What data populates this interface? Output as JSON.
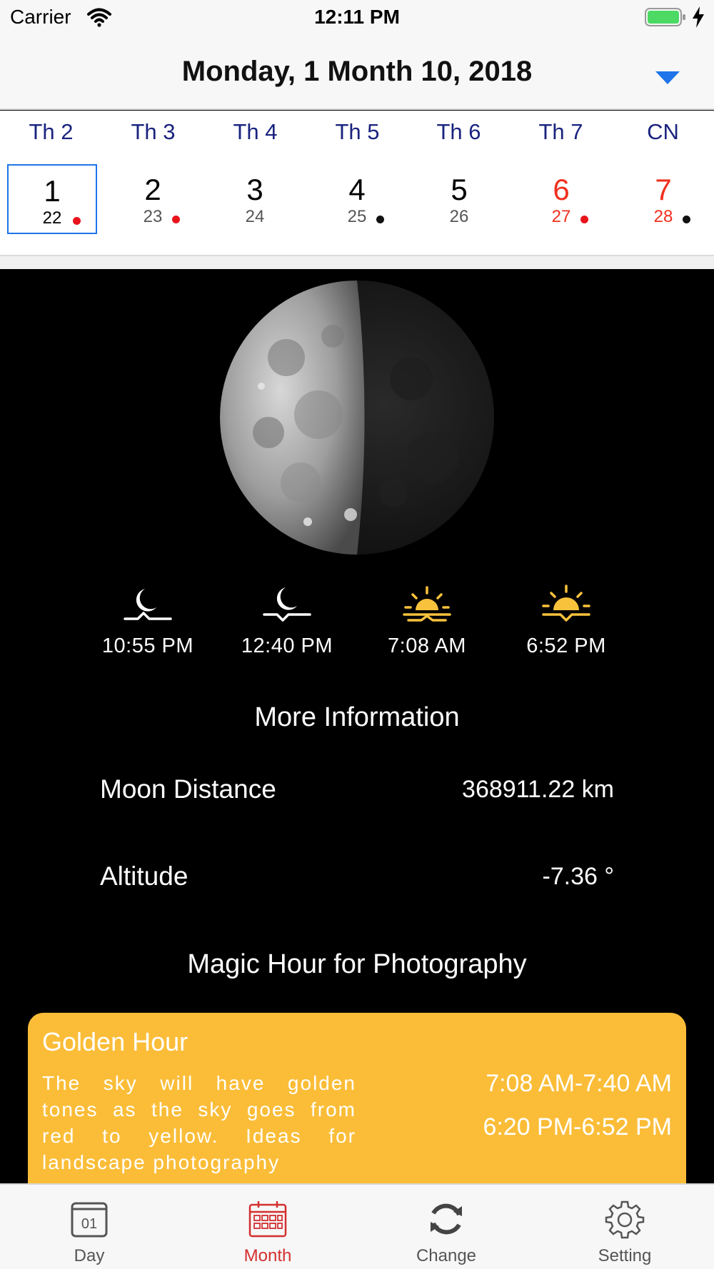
{
  "status_bar": {
    "carrier": "Carrier",
    "time": "12:11 PM"
  },
  "header": {
    "title": "Monday, 1 Month 10, 2018"
  },
  "week": {
    "weekdays": [
      "Th 2",
      "Th 3",
      "Th 4",
      "Th 5",
      "Th 6",
      "Th 7",
      "CN"
    ],
    "days": [
      {
        "day": "1",
        "lunar": "22",
        "dot": "red",
        "selected": true,
        "weekend": false
      },
      {
        "day": "2",
        "lunar": "23",
        "dot": "red",
        "selected": false,
        "weekend": false
      },
      {
        "day": "3",
        "lunar": "24",
        "dot": "",
        "selected": false,
        "weekend": false
      },
      {
        "day": "4",
        "lunar": "25",
        "dot": "black",
        "selected": false,
        "weekend": false
      },
      {
        "day": "5",
        "lunar": "26",
        "dot": "",
        "selected": false,
        "weekend": false
      },
      {
        "day": "6",
        "lunar": "27",
        "dot": "red",
        "selected": false,
        "weekend": true
      },
      {
        "day": "7",
        "lunar": "28",
        "dot": "black",
        "selected": false,
        "weekend": true
      }
    ]
  },
  "moon": {
    "phase_icon": "moon-phase-image",
    "rise_set": [
      {
        "icon": "moonrise-icon",
        "time": "10:55 PM"
      },
      {
        "icon": "moonset-icon",
        "time": "12:40 PM"
      },
      {
        "icon": "sunrise-icon",
        "time": "7:08 AM"
      },
      {
        "icon": "sunset-icon",
        "time": "6:52 PM"
      }
    ]
  },
  "more_info": {
    "title": "More Information",
    "distance_label": "Moon Distance",
    "distance_value": "368911.22 km",
    "altitude_label": "Altitude",
    "altitude_value": "-7.36 °"
  },
  "magic_hour": {
    "title": "Magic Hour for Photography",
    "golden": {
      "title": "Golden Hour",
      "description": "The sky will have golden tones as the sky goes from red to yellow. Ideas for landscape photography",
      "morning": "7:08 AM-7:40 AM",
      "evening": "6:20 PM-6:52 PM"
    }
  },
  "tabs": [
    {
      "label": "Day",
      "icon": "calendar-day-icon",
      "calendar_text": "01",
      "active": false
    },
    {
      "label": "Month",
      "icon": "calendar-month-icon",
      "active": true
    },
    {
      "label": "Change",
      "icon": "refresh-icon",
      "active": false
    },
    {
      "label": "Setting",
      "icon": "gear-icon",
      "active": false
    }
  ],
  "colors": {
    "accent_blue": "#1e74e8",
    "weekday_navy": "#1a237e",
    "weekend_red": "#f0301e",
    "golden_card": "#fbbd38",
    "sun_yellow": "#f9c23c",
    "tab_active": "#d32f2f"
  }
}
